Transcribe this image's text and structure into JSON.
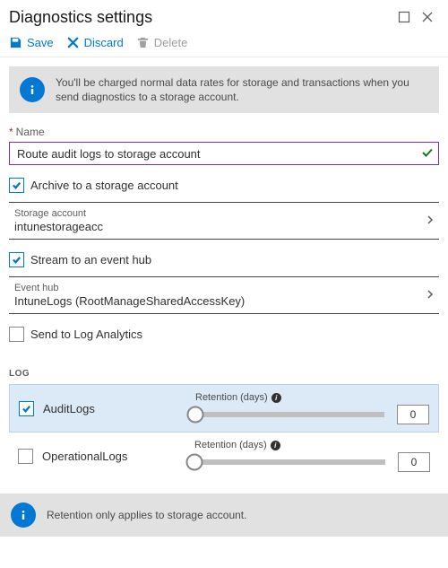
{
  "header": {
    "title": "Diagnostics settings"
  },
  "toolbar": {
    "save_label": "Save",
    "discard_label": "Discard",
    "delete_label": "Delete"
  },
  "info_banner": {
    "text": "You'll be charged normal data rates for storage and transactions when you send diagnostics to a storage account."
  },
  "name_field": {
    "label": "Name",
    "value": "Route audit logs to storage account"
  },
  "options": {
    "archive_label": "Archive to a storage account",
    "stream_label": "Stream to an event hub",
    "log_analytics_label": "Send to Log Analytics"
  },
  "storage_picker": {
    "label": "Storage account",
    "value": "intunestorageacc"
  },
  "eventhub_picker": {
    "label": "Event hub",
    "value": "IntuneLogs (RootManageSharedAccessKey)"
  },
  "log_section": {
    "header": "LOG",
    "retention_label": "Retention (days)",
    "rows": [
      {
        "name": "AuditLogs",
        "checked": true,
        "retention": "0"
      },
      {
        "name": "OperationalLogs",
        "checked": false,
        "retention": "0"
      }
    ]
  },
  "footer_info": {
    "text": "Retention only applies to storage account."
  }
}
